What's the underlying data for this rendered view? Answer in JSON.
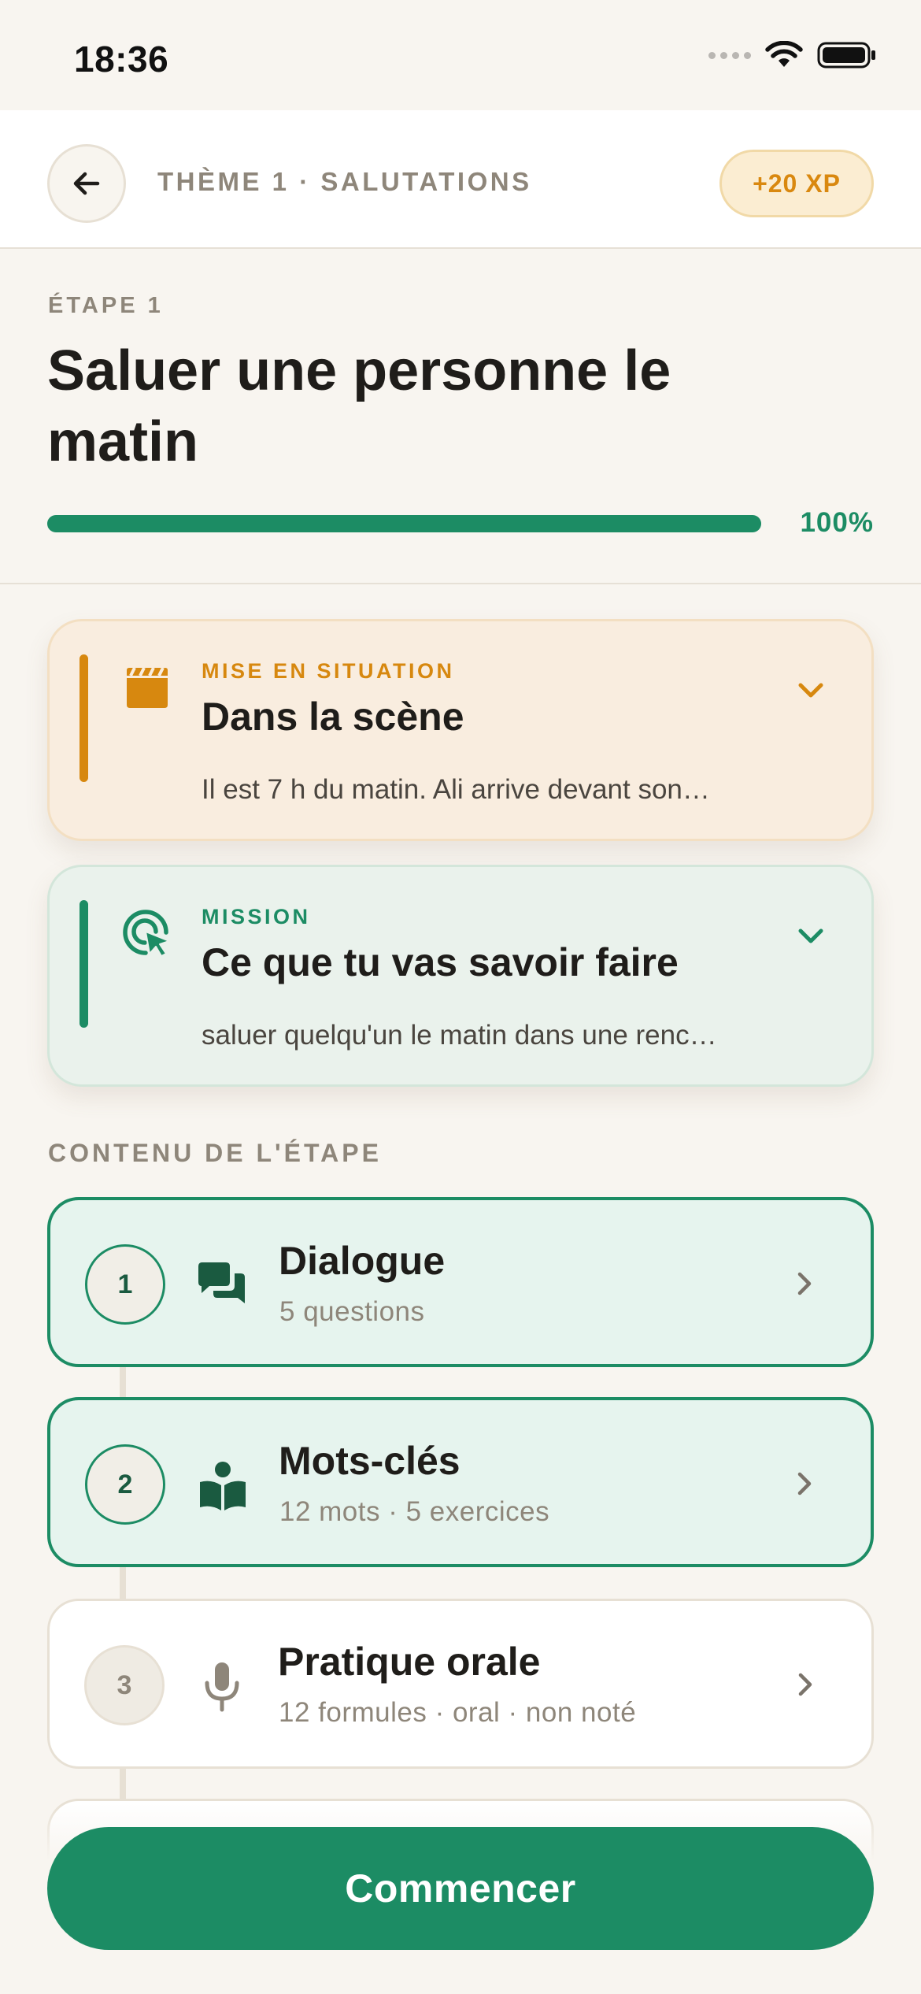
{
  "status_bar": {
    "time": "18:36"
  },
  "header": {
    "title": "THÈME 1 · SALUTATIONS",
    "xp": "+20 XP"
  },
  "step": {
    "label": "ÉTAPE 1",
    "title": "Saluer une personne le matin",
    "progress": 1.0,
    "progress_label": "100%"
  },
  "cards": [
    {
      "kicker": "MISE EN SITUATION",
      "title": "Dans la scène",
      "description": "Il est 7 h du matin. Ali arrive devant son…",
      "icon": "clapperboard-icon",
      "accent": "#d7880f"
    },
    {
      "kicker": "MISSION",
      "title": "Ce que tu vas savoir faire",
      "description": "saluer quelqu'un le matin dans une renc…",
      "icon": "target-icon",
      "accent": "#1c8c64"
    }
  ],
  "contents": {
    "label": "CONTENU DE L'ÉTAPE",
    "items": [
      {
        "number": "1",
        "title": "Dialogue",
        "subtitle": "5 questions",
        "icon": "chat-icon",
        "state": "done"
      },
      {
        "number": "2",
        "title": "Mots-clés",
        "subtitle": "12 mots · 5 exercices",
        "icon": "book-reader-icon",
        "state": "done"
      },
      {
        "number": "3",
        "title": "Pratique orale",
        "subtitle": "12 formules · oral · non noté",
        "icon": "microphone-icon",
        "state": "todo"
      }
    ]
  },
  "cta": {
    "label": "Commencer"
  },
  "colors": {
    "primary": "#1c8c64",
    "accent_orange": "#d7880f",
    "background": "#f8f5f0"
  }
}
